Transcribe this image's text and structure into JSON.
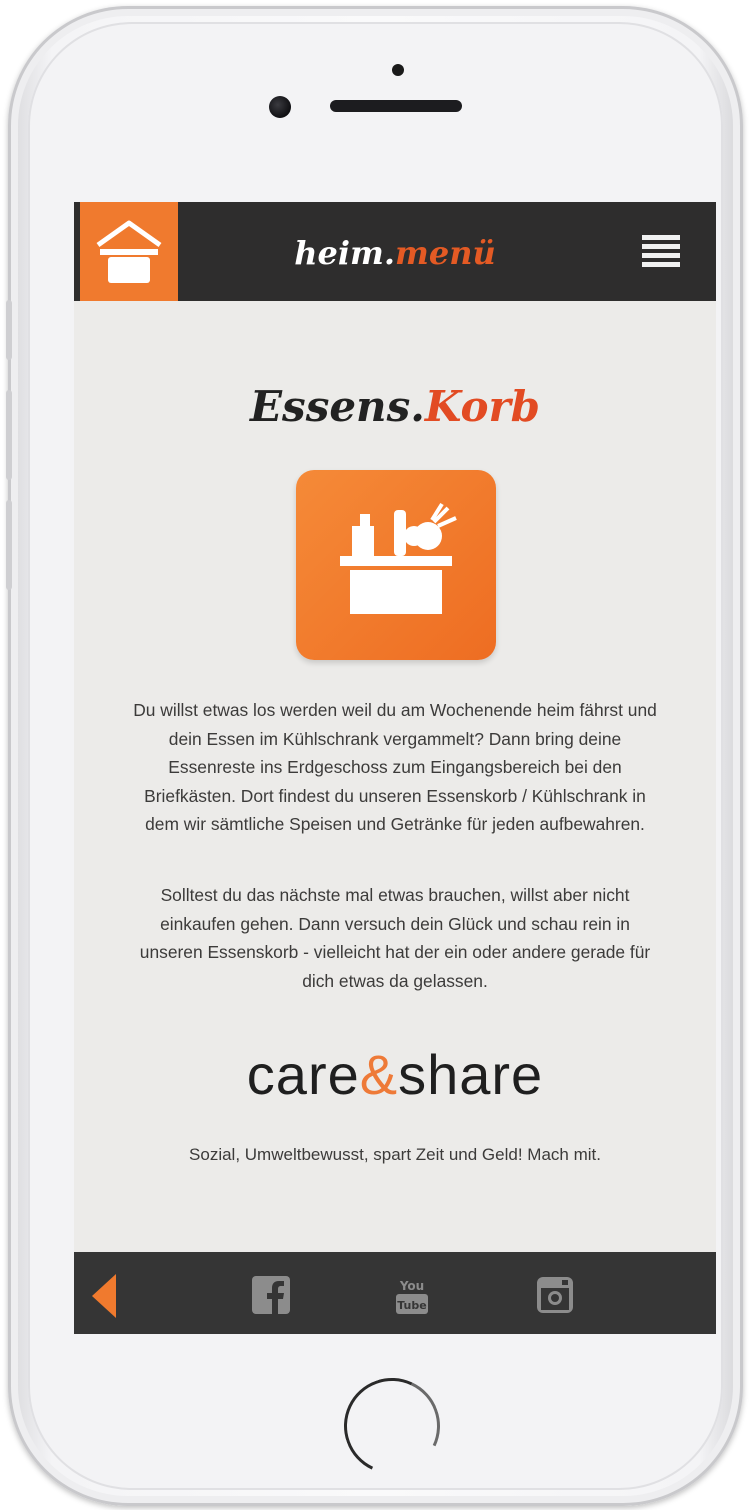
{
  "app": {
    "logo_part1": "heim.",
    "logo_part2": "menü"
  },
  "page": {
    "title_part1": "Essens.",
    "title_part2": "Korb"
  },
  "content": {
    "paragraph1": "Du willst etwas los werden weil du am Wochenende heim fährst und dein Essen im Kühlschrank vergammelt? Dann bring deine Essenreste ins Erdgeschoss zum Eingangsbereich bei den Briefkästen. Dort findest du unseren Essenskorb / Kühlschrank in dem wir sämtliche Speisen und Getränke für jeden aufbewahren.",
    "paragraph2": "Solltest du das nächste mal etwas brauchen, willst aber nicht einkaufen gehen. Dann versuch dein Glück und schau rein in unseren Essenskorb - vielleicht hat der ein oder andere gerade für dich etwas da gelassen.",
    "brand_part1": "care",
    "brand_amp": "&",
    "brand_part2": "share",
    "tagline": "Sozial, Umweltbewusst, spart Zeit und Geld! Mach mit."
  },
  "icons": {
    "home": "home-pot-icon",
    "menu": "hamburger-menu-icon",
    "basket": "food-basket-icon",
    "back": "back-arrow-icon",
    "facebook": "facebook-icon",
    "youtube": "youtube-icon",
    "instagram": "instagram-icon"
  },
  "colors": {
    "accent": "#f07a2e",
    "accent_dark": "#e45a24",
    "bar": "#2e2d2d",
    "screen_bg": "#ecebe9"
  }
}
